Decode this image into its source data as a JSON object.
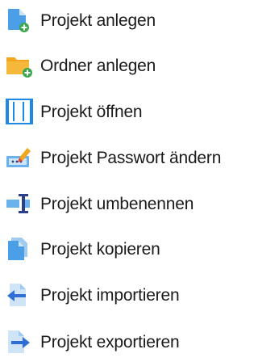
{
  "menu": {
    "items": [
      {
        "icon": "new-project-icon",
        "label": "Projekt anlegen"
      },
      {
        "icon": "new-folder-icon",
        "label": "Ordner anlegen"
      },
      {
        "icon": "open-project-icon",
        "label": "Projekt öffnen"
      },
      {
        "icon": "change-password-icon",
        "label": "Projekt Passwort ändern"
      },
      {
        "icon": "rename-icon",
        "label": "Projekt umbenennen"
      },
      {
        "icon": "copy-icon",
        "label": "Projekt kopieren"
      },
      {
        "icon": "import-icon",
        "label": "Projekt importieren"
      },
      {
        "icon": "export-icon",
        "label": "Projekt exportieren"
      }
    ]
  },
  "colors": {
    "doc_blue": "#4a9fe6",
    "doc_light": "#cfe5f7",
    "folder_orange": "#f2a51f",
    "badge_green": "#3aa84a",
    "arrow_blue": "#2e6fd6",
    "rename_blue": "#4a9fe6",
    "cursor_navy": "#2b3f8a"
  }
}
